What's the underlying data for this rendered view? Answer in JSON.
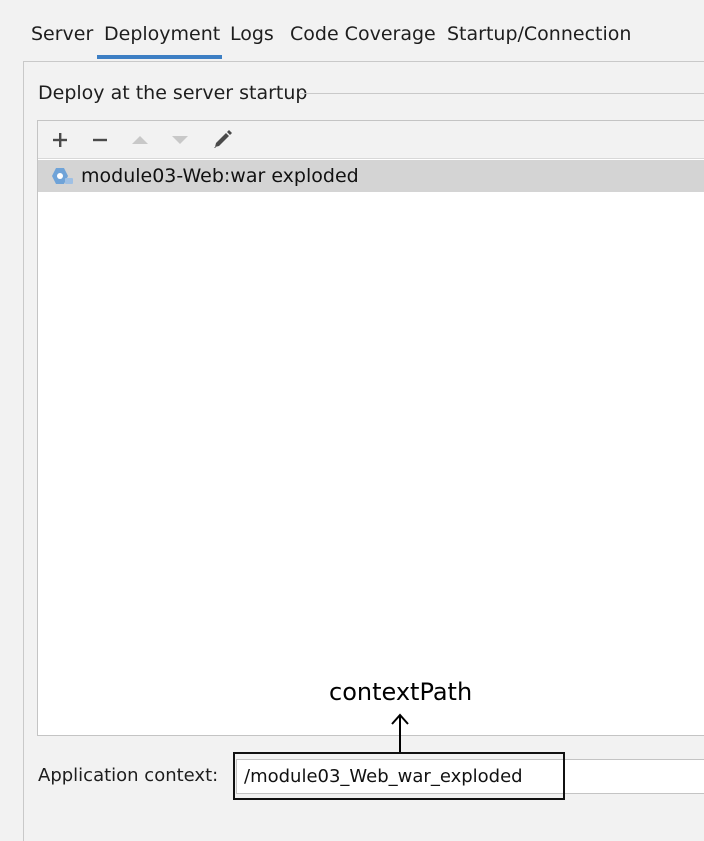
{
  "tabs": [
    {
      "label": "Server"
    },
    {
      "label": "Deployment"
    },
    {
      "label": "Logs"
    },
    {
      "label": "Code Coverage"
    },
    {
      "label": "Startup/Connection"
    }
  ],
  "active_tab": "Deployment",
  "deploy_group": {
    "label": "Deploy at the server startup"
  },
  "toolbar": {
    "buttons": [
      {
        "icon": "plus-icon"
      },
      {
        "icon": "minus-icon"
      },
      {
        "icon": "arrow-up-icon"
      },
      {
        "icon": "arrow-down-icon"
      },
      {
        "icon": "pencil-icon"
      }
    ]
  },
  "artifacts": [
    {
      "label": "module03-Web:war exploded",
      "icon": "artifact-icon",
      "selected": true
    }
  ],
  "annotation": {
    "text": "contextPath"
  },
  "application_context": {
    "label": "Application context:",
    "value": "/module03_Web_war_exploded"
  },
  "colors": {
    "accent": "#3d7fc4",
    "selected_row": "#d4d4d4",
    "background": "#f2f2f2"
  }
}
